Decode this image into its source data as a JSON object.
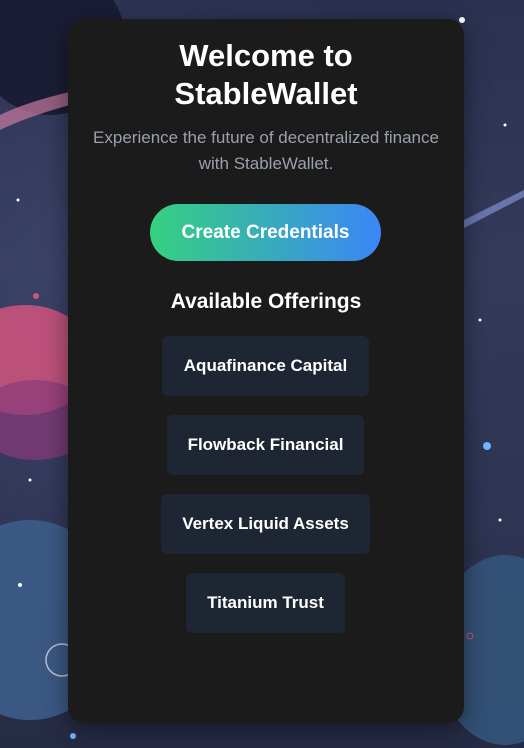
{
  "welcome": {
    "title_line1": "Welcome to",
    "title_line2": "StableWallet",
    "subtitle": "Experience the future of decentralized finance with StableWallet."
  },
  "cta": {
    "label": "Create Credentials"
  },
  "offerings": {
    "heading": "Available Offerings",
    "items": [
      {
        "label": "Aquafinance Capital"
      },
      {
        "label": "Flowback Financial"
      },
      {
        "label": "Vertex Liquid Assets"
      },
      {
        "label": "Titanium Trust"
      }
    ]
  },
  "colors": {
    "card_bg": "#1b1b1b",
    "offer_bg": "#1e2633",
    "cta_gradient_start": "#35d17f",
    "cta_gradient_end": "#3b86f7",
    "subtitle_text": "#9aa0ad"
  }
}
